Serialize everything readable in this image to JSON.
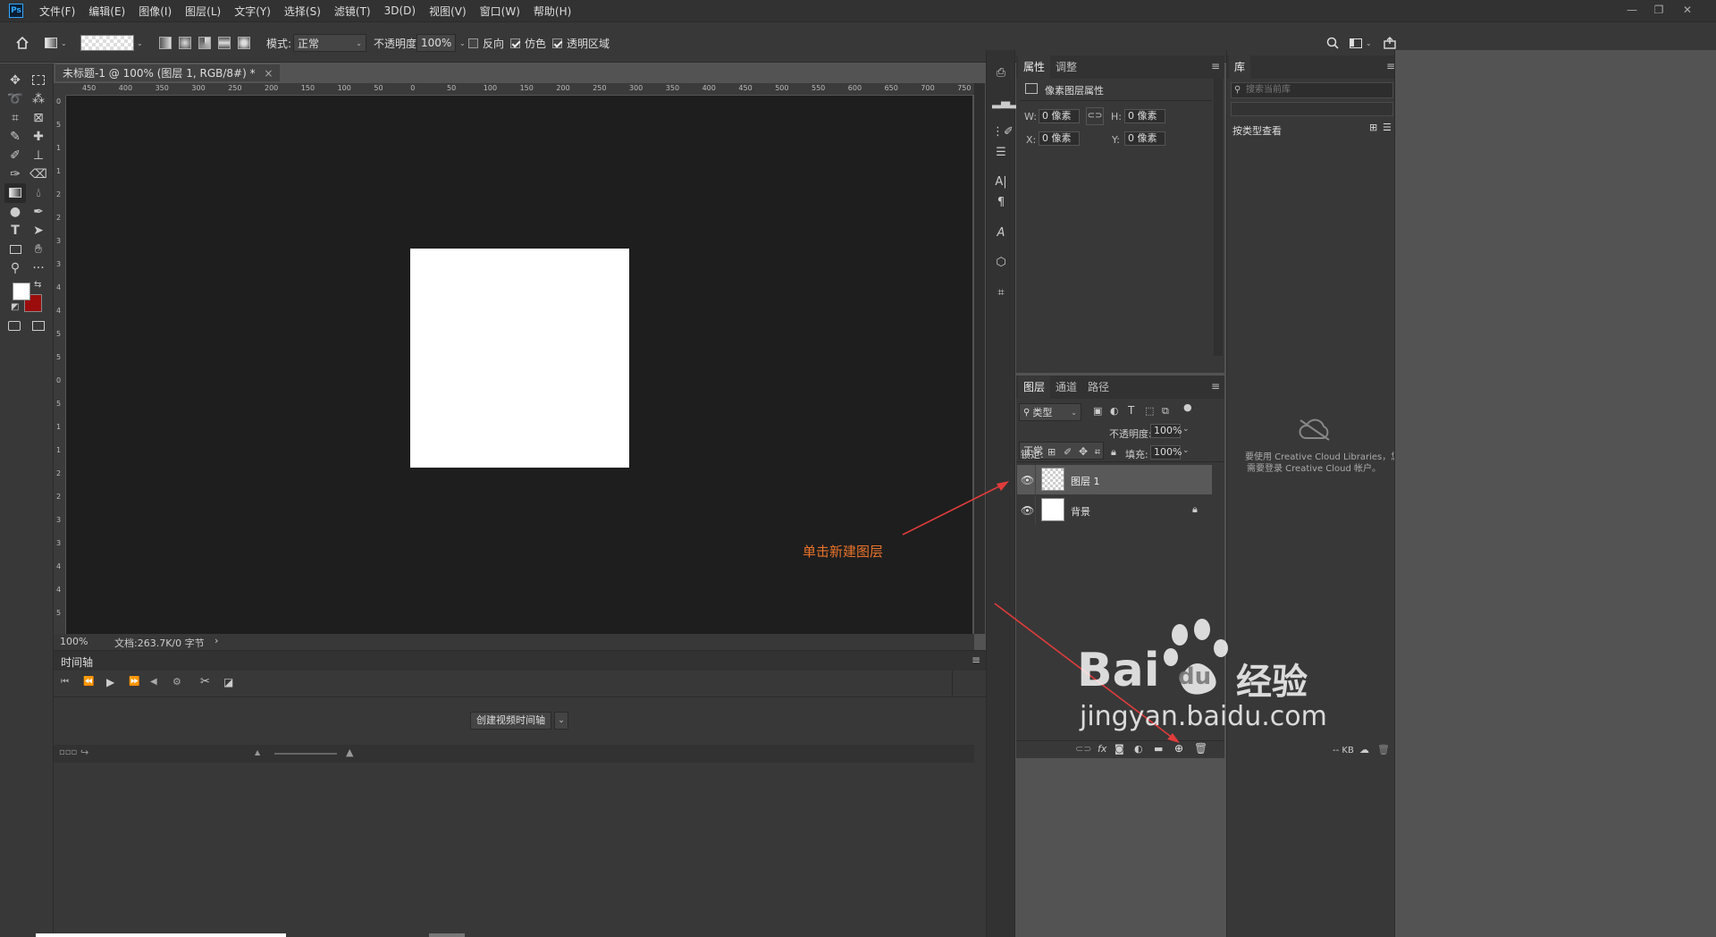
{
  "app": {
    "logo": "Ps",
    "menu": [
      "文件(F)",
      "编辑(E)",
      "图像(I)",
      "图层(L)",
      "文字(Y)",
      "选择(S)",
      "滤镜(T)",
      "3D(D)",
      "视图(V)",
      "窗口(W)",
      "帮助(H)"
    ],
    "window_controls": [
      "—",
      "❐",
      "✕"
    ]
  },
  "options_bar": {
    "mode_label": "模式:",
    "mode_value": "正常",
    "opacity_label": "不透明度:",
    "opacity_value": "100%",
    "reverse_label": "反向",
    "dither_label": "仿色",
    "transparency_label": "透明区域"
  },
  "document": {
    "tab_title": "未标题-1 @ 100% (图层 1, RGB/8#) *",
    "tab_close": "×",
    "zoom": "100%",
    "doc_info": "文档:263.7K/0 字节",
    "info_arrow": "›",
    "ruler_h": [
      "450",
      "400",
      "350",
      "300",
      "250",
      "200",
      "150",
      "100",
      "50",
      "0",
      "50",
      "100",
      "150",
      "200",
      "250",
      "300",
      "350",
      "400",
      "450",
      "500",
      "550",
      "600",
      "650",
      "700",
      "750"
    ],
    "ruler_v": [
      "0",
      "5",
      "1",
      "1",
      "2",
      "2",
      "3",
      "3",
      "4",
      "4",
      "5",
      "5",
      "0",
      "5",
      "1",
      "1",
      "2",
      "2",
      "3",
      "3",
      "4",
      "4",
      "5"
    ]
  },
  "timeline": {
    "title": "时间轴",
    "create_button": "创建视频时间轴",
    "menu_icon": "≡"
  },
  "properties_panel": {
    "tabs": [
      "属性",
      "调整"
    ],
    "section_title": "像素图层属性",
    "w_label": "W:",
    "w_value": "0 像素",
    "h_label": "H:",
    "h_value": "0 像素",
    "x_label": "X:",
    "x_value": "0 像素",
    "y_label": "Y:",
    "y_value": "0 像素"
  },
  "layers_panel": {
    "tabs": [
      "图层",
      "通道",
      "路径"
    ],
    "filter_kind": "类型",
    "blend_mode": "正常",
    "opacity_label": "不透明度:",
    "opacity_value": "100%",
    "lock_label": "锁定:",
    "fill_label": "填充:",
    "fill_value": "100%",
    "layers": [
      {
        "name": "图层 1",
        "selected": true,
        "locked": false
      },
      {
        "name": "背景",
        "selected": false,
        "locked": true
      }
    ],
    "footer_icons": [
      "link-icon",
      "fx-icon",
      "mask-icon",
      "adjustment-icon",
      "group-folder-icon",
      "new-layer-icon",
      "trash-icon"
    ]
  },
  "library_panel": {
    "tab": "库",
    "search_placeholder": "搜索当前库",
    "view_by": "按类型查看",
    "message_line1": "要使用 Creative Cloud Libraries，您",
    "message_line2": "需要登录 Creative Cloud 帐户。",
    "size_label": "-- KB"
  },
  "annotation": {
    "text": "单击新建图层",
    "color": "#e8722a"
  },
  "watermark": {
    "brand": "Bai",
    "brand2": "du",
    "cn": "经验",
    "url": "jingyan.baidu.com"
  },
  "colors": {
    "foreground": "#ffffff",
    "background": "#9b0c0c",
    "canvas_bg": "#1e1e1e",
    "panel_bg": "#383838",
    "accent": "#31a8ff"
  }
}
